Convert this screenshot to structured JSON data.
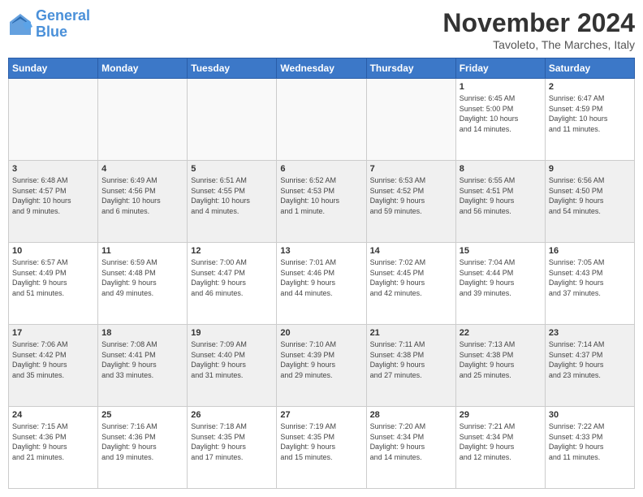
{
  "header": {
    "logo_line1": "General",
    "logo_line2": "Blue",
    "month_title": "November 2024",
    "location": "Tavoleto, The Marches, Italy"
  },
  "day_headers": [
    "Sunday",
    "Monday",
    "Tuesday",
    "Wednesday",
    "Thursday",
    "Friday",
    "Saturday"
  ],
  "weeks": [
    {
      "cells": [
        {
          "day": "",
          "info": "",
          "empty": true
        },
        {
          "day": "",
          "info": "",
          "empty": true
        },
        {
          "day": "",
          "info": "",
          "empty": true
        },
        {
          "day": "",
          "info": "",
          "empty": true
        },
        {
          "day": "",
          "info": "",
          "empty": true
        },
        {
          "day": "1",
          "info": "Sunrise: 6:45 AM\nSunset: 5:00 PM\nDaylight: 10 hours\nand 14 minutes."
        },
        {
          "day": "2",
          "info": "Sunrise: 6:47 AM\nSunset: 4:59 PM\nDaylight: 10 hours\nand 11 minutes."
        }
      ]
    },
    {
      "cells": [
        {
          "day": "3",
          "info": "Sunrise: 6:48 AM\nSunset: 4:57 PM\nDaylight: 10 hours\nand 9 minutes."
        },
        {
          "day": "4",
          "info": "Sunrise: 6:49 AM\nSunset: 4:56 PM\nDaylight: 10 hours\nand 6 minutes."
        },
        {
          "day": "5",
          "info": "Sunrise: 6:51 AM\nSunset: 4:55 PM\nDaylight: 10 hours\nand 4 minutes."
        },
        {
          "day": "6",
          "info": "Sunrise: 6:52 AM\nSunset: 4:53 PM\nDaylight: 10 hours\nand 1 minute."
        },
        {
          "day": "7",
          "info": "Sunrise: 6:53 AM\nSunset: 4:52 PM\nDaylight: 9 hours\nand 59 minutes."
        },
        {
          "day": "8",
          "info": "Sunrise: 6:55 AM\nSunset: 4:51 PM\nDaylight: 9 hours\nand 56 minutes."
        },
        {
          "day": "9",
          "info": "Sunrise: 6:56 AM\nSunset: 4:50 PM\nDaylight: 9 hours\nand 54 minutes."
        }
      ]
    },
    {
      "cells": [
        {
          "day": "10",
          "info": "Sunrise: 6:57 AM\nSunset: 4:49 PM\nDaylight: 9 hours\nand 51 minutes."
        },
        {
          "day": "11",
          "info": "Sunrise: 6:59 AM\nSunset: 4:48 PM\nDaylight: 9 hours\nand 49 minutes."
        },
        {
          "day": "12",
          "info": "Sunrise: 7:00 AM\nSunset: 4:47 PM\nDaylight: 9 hours\nand 46 minutes."
        },
        {
          "day": "13",
          "info": "Sunrise: 7:01 AM\nSunset: 4:46 PM\nDaylight: 9 hours\nand 44 minutes."
        },
        {
          "day": "14",
          "info": "Sunrise: 7:02 AM\nSunset: 4:45 PM\nDaylight: 9 hours\nand 42 minutes."
        },
        {
          "day": "15",
          "info": "Sunrise: 7:04 AM\nSunset: 4:44 PM\nDaylight: 9 hours\nand 39 minutes."
        },
        {
          "day": "16",
          "info": "Sunrise: 7:05 AM\nSunset: 4:43 PM\nDaylight: 9 hours\nand 37 minutes."
        }
      ]
    },
    {
      "cells": [
        {
          "day": "17",
          "info": "Sunrise: 7:06 AM\nSunset: 4:42 PM\nDaylight: 9 hours\nand 35 minutes."
        },
        {
          "day": "18",
          "info": "Sunrise: 7:08 AM\nSunset: 4:41 PM\nDaylight: 9 hours\nand 33 minutes."
        },
        {
          "day": "19",
          "info": "Sunrise: 7:09 AM\nSunset: 4:40 PM\nDaylight: 9 hours\nand 31 minutes."
        },
        {
          "day": "20",
          "info": "Sunrise: 7:10 AM\nSunset: 4:39 PM\nDaylight: 9 hours\nand 29 minutes."
        },
        {
          "day": "21",
          "info": "Sunrise: 7:11 AM\nSunset: 4:38 PM\nDaylight: 9 hours\nand 27 minutes."
        },
        {
          "day": "22",
          "info": "Sunrise: 7:13 AM\nSunset: 4:38 PM\nDaylight: 9 hours\nand 25 minutes."
        },
        {
          "day": "23",
          "info": "Sunrise: 7:14 AM\nSunset: 4:37 PM\nDaylight: 9 hours\nand 23 minutes."
        }
      ]
    },
    {
      "cells": [
        {
          "day": "24",
          "info": "Sunrise: 7:15 AM\nSunset: 4:36 PM\nDaylight: 9 hours\nand 21 minutes."
        },
        {
          "day": "25",
          "info": "Sunrise: 7:16 AM\nSunset: 4:36 PM\nDaylight: 9 hours\nand 19 minutes."
        },
        {
          "day": "26",
          "info": "Sunrise: 7:18 AM\nSunset: 4:35 PM\nDaylight: 9 hours\nand 17 minutes."
        },
        {
          "day": "27",
          "info": "Sunrise: 7:19 AM\nSunset: 4:35 PM\nDaylight: 9 hours\nand 15 minutes."
        },
        {
          "day": "28",
          "info": "Sunrise: 7:20 AM\nSunset: 4:34 PM\nDaylight: 9 hours\nand 14 minutes."
        },
        {
          "day": "29",
          "info": "Sunrise: 7:21 AM\nSunset: 4:34 PM\nDaylight: 9 hours\nand 12 minutes."
        },
        {
          "day": "30",
          "info": "Sunrise: 7:22 AM\nSunset: 4:33 PM\nDaylight: 9 hours\nand 11 minutes."
        }
      ]
    }
  ]
}
